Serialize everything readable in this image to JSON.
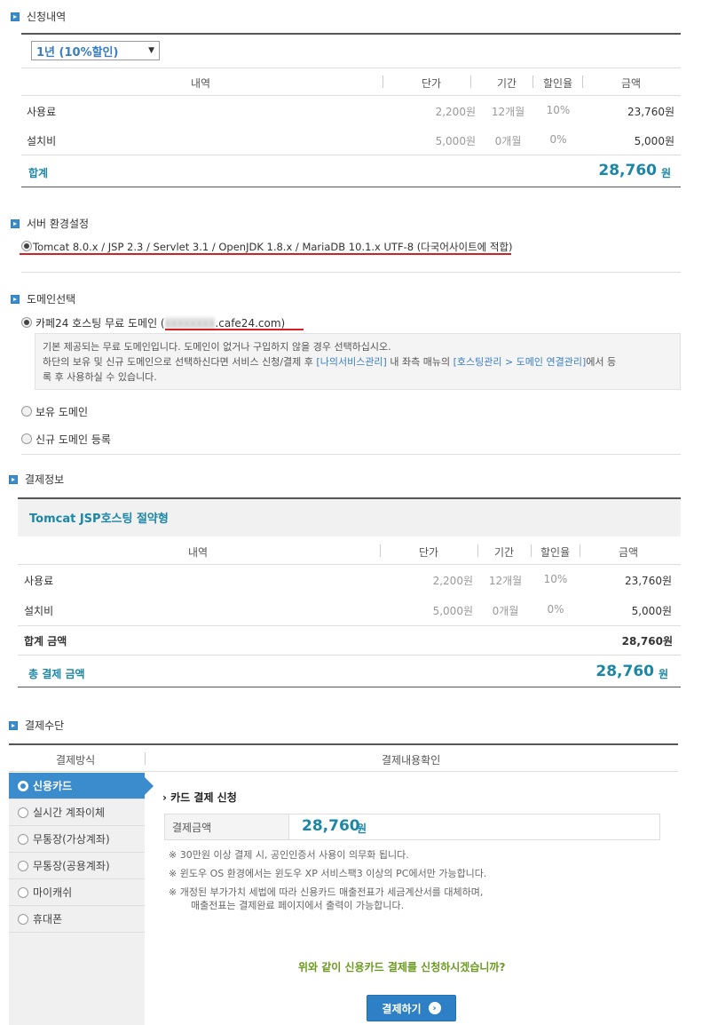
{
  "sections": {
    "application": "신청내역",
    "server_env": "서버 환경설정",
    "domain": "도메인선택",
    "payment_info": "결제정보",
    "payment_method": "결제수단"
  },
  "period_select": {
    "value": "1년 (10%할인)"
  },
  "table_headers": {
    "item": "내역",
    "unit_price": "단가",
    "period": "기간",
    "discount": "할인율",
    "amount": "금액"
  },
  "rows": [
    {
      "name": "사용료",
      "unit_price": "2,200원",
      "period": "12개월",
      "discount": "10%",
      "amount": "23,760원"
    },
    {
      "name": "설치비",
      "unit_price": "5,000원",
      "period": "0개월",
      "discount": "0%",
      "amount": "5,000원"
    }
  ],
  "total": {
    "label": "합계",
    "value": "28,760",
    "unit": "원"
  },
  "server_option": "Tomcat 8.0.x / JSP 2.3 / Servlet 3.1 / OpenJDK 1.8.x / MariaDB 10.1.x UTF-8 (다국어사이트에 적합)",
  "domain_options": {
    "free_prefix": "카페24 호스팅 무료 도메인 (",
    "free_blurred": "xxxxxxxx",
    "free_suffix": ".cafe24.com)",
    "owned": "보유 도메인",
    "new": "신규 도메인 등록"
  },
  "info": {
    "line1": "기본 제공되는 무료 도메인입니다. 도메인이 없거나 구입하지 않을 경우 선택하십시오.",
    "line2_a": "하단의 보유 및 신규 도메인으로 선택하신다면 서비스 신청/결제 후 ",
    "link1": "[나의서비스관리]",
    "line2_b": " 내 좌측 매뉴의 ",
    "link2": "[호스팅관리 > 도메인 연결관리]",
    "line2_c": "에서 등",
    "line3": "록 후 사용하실 수 있습니다."
  },
  "plan_title": "Tomcat JSP호스팅 절약형",
  "total_amount": {
    "label": "합계 금액",
    "value": "28,760원"
  },
  "grand_total": {
    "label": "총 결제 금액",
    "value": "28,760",
    "unit": "원"
  },
  "method_headers": {
    "method": "결제방식",
    "confirm": "결제내용확인"
  },
  "methods": [
    "신용카드",
    "실시간 계좌이체",
    "무통장(가상계좌)",
    "무통장(공용계좌)",
    "마이캐쉬",
    "휴대폰"
  ],
  "card": {
    "title": "카드 결제 신청",
    "amount_label": "결제금액",
    "amount_value": "28,760",
    "amount_unit": "원",
    "notes": [
      "※ 30만원 이상 결제 시, 공인인증서 사용이 의무화 됩니다.",
      "※ 윈도우 OS 환경에서는 윈도우 XP 서비스팩3 이상의 PC에서만 가능합니다.",
      "※ 개정된 부가가치 세법에 따라 신용카드 매출전표가 세금계산서를 대체하며,",
      "매출전표는 결제완료 페이지에서 출력이 가능합니다."
    ],
    "question": "위와 같이 신용카드 결제를 신청하시겠습니까?",
    "button": "결제하기"
  }
}
